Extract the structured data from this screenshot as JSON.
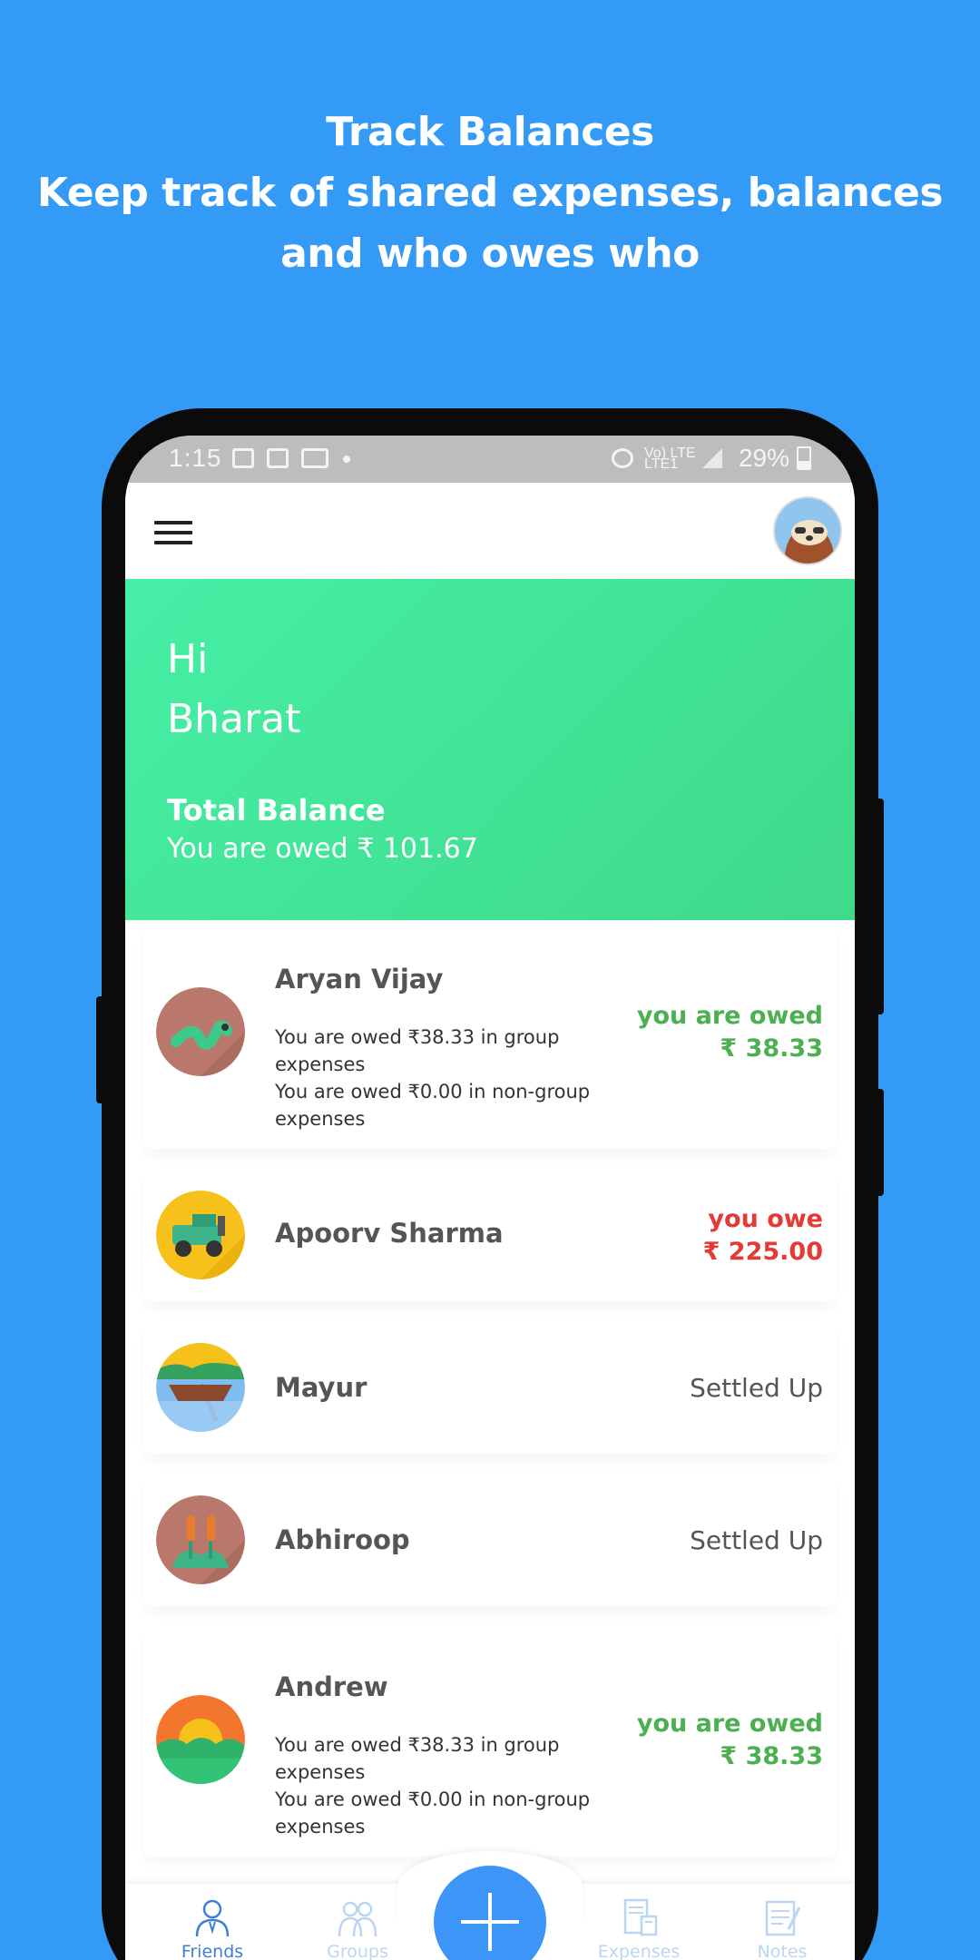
{
  "promo": {
    "line1": "Track Balances",
    "line2": "Keep track of shared expenses, balances",
    "line3": "and who owes who"
  },
  "status_bar": {
    "time": "1:15",
    "carrier_top": "Vo) LTE",
    "carrier_bottom": "LTE1",
    "battery": "29%"
  },
  "hero": {
    "greeting": "Hi",
    "name": "Bharat",
    "balance_title": "Total Balance",
    "balance_text": "You are owed ₹ 101.67"
  },
  "friends": [
    {
      "name": "Aryan Vijay",
      "detail1": "You are owed ₹38.33 in group expenses",
      "detail2": "You are owed ₹0.00 in non-group expenses",
      "status_line1": "you are owed",
      "status_line2": "₹ 38.33",
      "status_color": "#4CAF50"
    },
    {
      "name": "Apoorv Sharma",
      "detail1": "",
      "detail2": "",
      "status_line1": "you owe",
      "status_line2": "₹ 225.00",
      "status_color": "#E53935"
    },
    {
      "name": "Mayur",
      "detail1": "",
      "detail2": "",
      "status_line1": "Settled Up",
      "status_line2": "",
      "status_color": "#555555"
    },
    {
      "name": "Abhiroop",
      "detail1": "",
      "detail2": "",
      "status_line1": "Settled Up",
      "status_line2": "",
      "status_color": "#555555"
    },
    {
      "name": "Andrew",
      "detail1": "You are owed ₹38.33 in group expenses",
      "detail2": "You are owed ₹0.00 in non-group expenses",
      "status_line1": "you are owed",
      "status_line2": "₹ 38.33",
      "status_color": "#4CAF50"
    }
  ],
  "bottom_nav": {
    "friends": "Friends",
    "groups": "Groups",
    "expenses": "Expenses",
    "notes": "Notes"
  },
  "icons": {
    "menu": "hamburger-icon",
    "add": "plus-icon",
    "profile": "sloth-avatar"
  },
  "colors": {
    "background": "#339AF5",
    "hero_start": "#45EFA5",
    "hero_end": "#3FD98A",
    "owed": "#4CAF50",
    "owe": "#E53935",
    "fab": "#3D95F8",
    "nav_active": "#3D7FD6"
  }
}
